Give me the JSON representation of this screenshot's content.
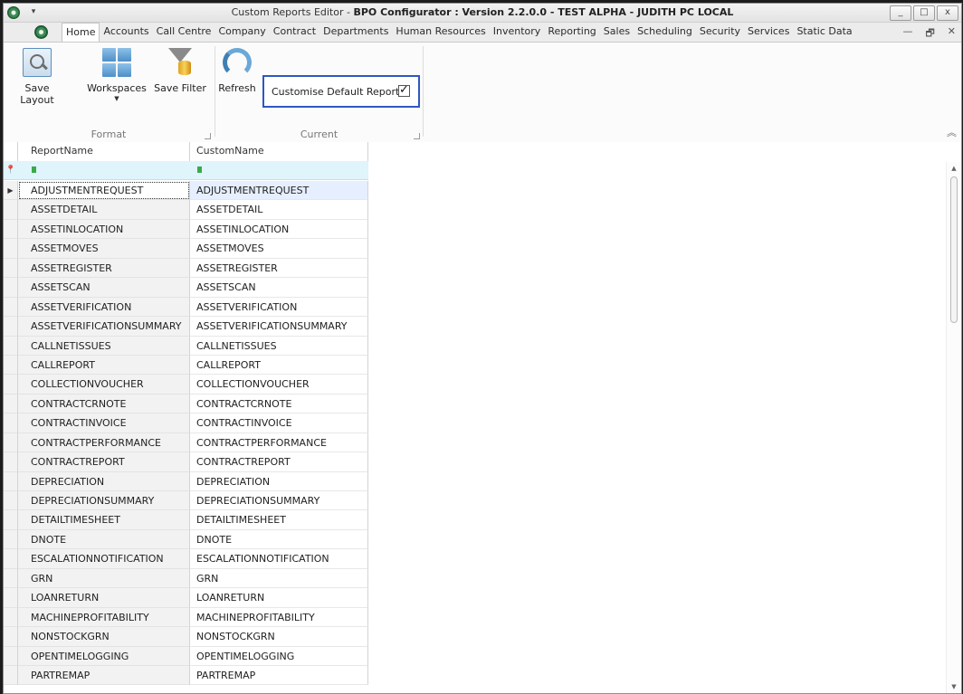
{
  "window": {
    "title_prefix": "Custom Reports Editor - ",
    "title_bold": "BPO Configurator : Version 2.2.0.0 - TEST ALPHA - JUDITH PC LOCAL",
    "controls": [
      "_",
      "□",
      "x"
    ]
  },
  "quick_access": "▾",
  "menu": {
    "tabs": [
      "Home",
      "Accounts",
      "Call Centre",
      "Company",
      "Contract",
      "Departments",
      "Human Resources",
      "Inventory",
      "Reporting",
      "Sales",
      "Scheduling",
      "Security",
      "Services",
      "Static Data"
    ],
    "active_tab": "Home",
    "mdi_controls": [
      "—",
      "🗗",
      "✕"
    ]
  },
  "ribbon": {
    "format_group": {
      "label": "Format",
      "save_layout": "Save Layout",
      "workspaces": "Workspaces",
      "save_filter": "Save Filter"
    },
    "current_group": {
      "label": "Current",
      "refresh": "Refresh",
      "customise_label": "Customise Default Reports",
      "customise_checked": true,
      "check_mark": "✓"
    },
    "collapse_glyph": "︽"
  },
  "grid": {
    "columns": [
      "ReportName",
      "CustomName"
    ],
    "filter_pin": "📍",
    "filter_glyph_text": "ᴬᴮᶜ",
    "focused_indicator": "▶",
    "rows": [
      [
        "ADJUSTMENTREQUEST",
        "ADJUSTMENTREQUEST"
      ],
      [
        "ASSETDETAIL",
        "ASSETDETAIL"
      ],
      [
        "ASSETINLOCATION",
        "ASSETINLOCATION"
      ],
      [
        "ASSETMOVES",
        "ASSETMOVES"
      ],
      [
        "ASSETREGISTER",
        "ASSETREGISTER"
      ],
      [
        "ASSETSCAN",
        "ASSETSCAN"
      ],
      [
        "ASSETVERIFICATION",
        "ASSETVERIFICATION"
      ],
      [
        "ASSETVERIFICATIONSUMMARY",
        "ASSETVERIFICATIONSUMMARY"
      ],
      [
        "CALLNETISSUES",
        "CALLNETISSUES"
      ],
      [
        "CALLREPORT",
        "CALLREPORT"
      ],
      [
        "COLLECTIONVOUCHER",
        "COLLECTIONVOUCHER"
      ],
      [
        "CONTRACTCRNOTE",
        "CONTRACTCRNOTE"
      ],
      [
        "CONTRACTINVOICE",
        "CONTRACTINVOICE"
      ],
      [
        "CONTRACTPERFORMANCE",
        "CONTRACTPERFORMANCE"
      ],
      [
        "CONTRACTREPORT",
        "CONTRACTREPORT"
      ],
      [
        "DEPRECIATION",
        "DEPRECIATION"
      ],
      [
        "DEPRECIATIONSUMMARY",
        "DEPRECIATIONSUMMARY"
      ],
      [
        "DETAILTIMESHEET",
        "DETAILTIMESHEET"
      ],
      [
        "DNOTE",
        "DNOTE"
      ],
      [
        "ESCALATIONNOTIFICATION",
        "ESCALATIONNOTIFICATION"
      ],
      [
        "GRN",
        "GRN"
      ],
      [
        "LOANRETURN",
        "LOANRETURN"
      ],
      [
        "MACHINEPROFITABILITY",
        "MACHINEPROFITABILITY"
      ],
      [
        "NONSTOCKGRN",
        "NONSTOCKGRN"
      ],
      [
        "OPENTIMELOGGING",
        "OPENTIMELOGGING"
      ],
      [
        "PARTREMAP",
        "PARTREMAP"
      ]
    ],
    "scroll_up": "▲",
    "scroll_down": "▼"
  },
  "colors": {
    "accent_border": "#2f56c2",
    "filter_row": "#dff4fb",
    "focused_cell": "#e6efff"
  }
}
